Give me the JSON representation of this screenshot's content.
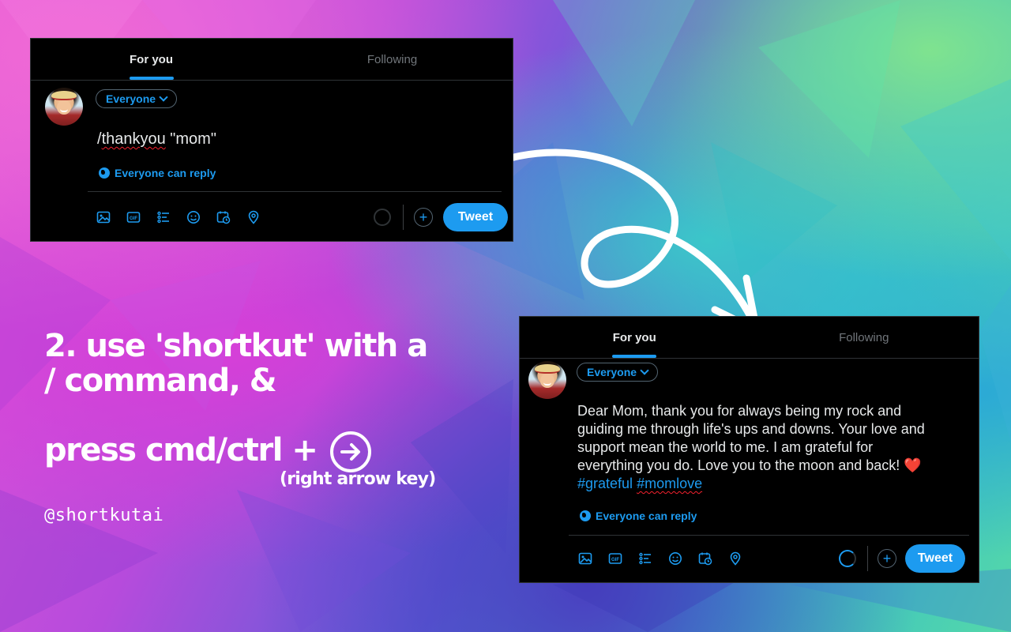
{
  "panel1": {
    "tabs": [
      {
        "label": "For you",
        "active": true
      },
      {
        "label": "Following",
        "active": false
      }
    ],
    "audience": "Everyone",
    "text_parts": [
      "/",
      "thankyou",
      " \"mom\""
    ],
    "reply_note": "Everyone can reply",
    "tweet_button": "Tweet"
  },
  "panel2": {
    "tabs": [
      {
        "label": "For you",
        "active": true
      },
      {
        "label": "Following",
        "active": false
      }
    ],
    "audience": "Everyone",
    "lines": [
      "Dear Mom, thank you for always being my rock and",
      "guiding me through life's ups and downs. Your love and",
      "support mean the world to me. I am grateful for",
      "everything you do. Love you to the moon and back! ❤️"
    ],
    "hashtag1": "#grateful",
    "hashtag2": "#momlove",
    "reply_note": "Everyone can reply",
    "tweet_button": "Tweet"
  },
  "toolbar_icons": [
    "image-icon",
    "gif-icon",
    "poll-icon",
    "emoji-icon",
    "schedule-icon",
    "location-icon"
  ],
  "headline": {
    "line1": "2. use 'shortkut' with a",
    "line2": "/ command, &",
    "line3": "press cmd/ctrl +",
    "subnote": "(right arrow key)",
    "handle": "@shortkutai"
  },
  "colors": {
    "twitter_blue": "#1d9bf0",
    "panel_bg": "#000000",
    "text_primary": "#e7e9ea",
    "text_muted": "#71767b"
  }
}
